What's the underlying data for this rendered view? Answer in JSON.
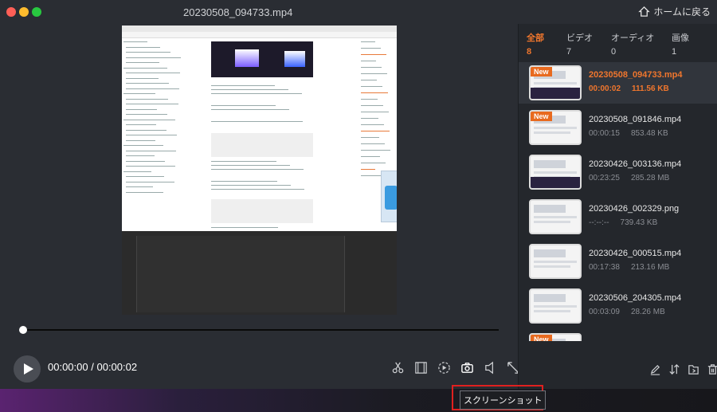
{
  "window": {
    "title": "20230508_094733.mp4",
    "home_label": "ホームに戻る"
  },
  "player": {
    "current_time": "00:00:00",
    "separator": "/",
    "duration": "00:00:02",
    "progress_fraction": 0.0,
    "tools": [
      "scissors-icon",
      "film-frames-icon",
      "speed-icon",
      "camera-icon",
      "speaker-icon",
      "expand-icon"
    ]
  },
  "categories": [
    {
      "label": "全部",
      "count": "8",
      "active": true
    },
    {
      "label": "ビデオ",
      "count": "7",
      "active": false
    },
    {
      "label": "オーディオ",
      "count": "0",
      "active": false
    },
    {
      "label": "画像",
      "count": "1",
      "active": false
    }
  ],
  "files": [
    {
      "name": "20230508_094733.mp4",
      "time": "00:00:02",
      "size": "111.56 KB",
      "new": true,
      "selected": true
    },
    {
      "name": "20230508_091846.mp4",
      "time": "00:00:15",
      "size": "853.48 KB",
      "new": true,
      "selected": false
    },
    {
      "name": "20230426_003136.mp4",
      "time": "00:23:25",
      "size": "285.28 MB",
      "new": false,
      "selected": false
    },
    {
      "name": "20230426_002329.png",
      "time": "--:--:--",
      "size": "739.43 KB",
      "new": false,
      "selected": false
    },
    {
      "name": "20230426_000515.mp4",
      "time": "00:17:38",
      "size": "213.16 MB",
      "new": false,
      "selected": false
    },
    {
      "name": "20230506_204305.mp4",
      "time": "00:03:09",
      "size": "28.26 MB",
      "new": false,
      "selected": false
    },
    {
      "name": "",
      "time": "",
      "size": "",
      "new": true,
      "selected": false
    }
  ],
  "new_badge": "New",
  "tooltip": {
    "label": "スクリーンショット"
  },
  "colors": {
    "accent": "#f0762d",
    "highlight": "#e0201f",
    "panel": "#24272c"
  }
}
